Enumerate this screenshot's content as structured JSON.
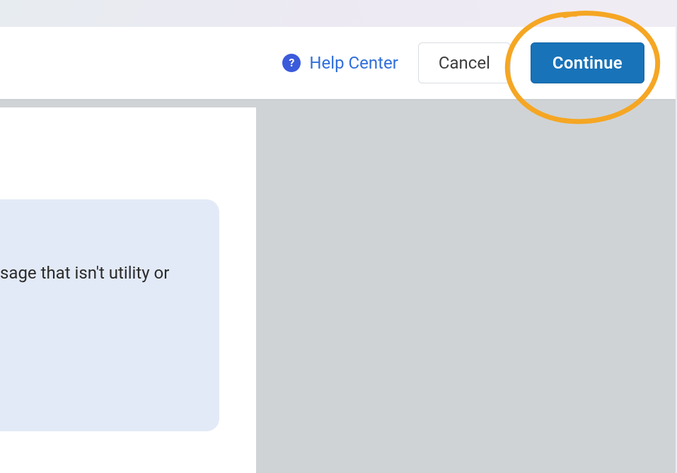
{
  "header": {
    "help_label": "Help Center",
    "cancel_label": "Cancel",
    "continue_label": "Continue"
  },
  "panel": {
    "text_fragment": "sage that isn't utility or"
  },
  "annotation": {
    "shape": "hand-drawn-circle",
    "color": "#f5a623",
    "target": "continue-button"
  }
}
